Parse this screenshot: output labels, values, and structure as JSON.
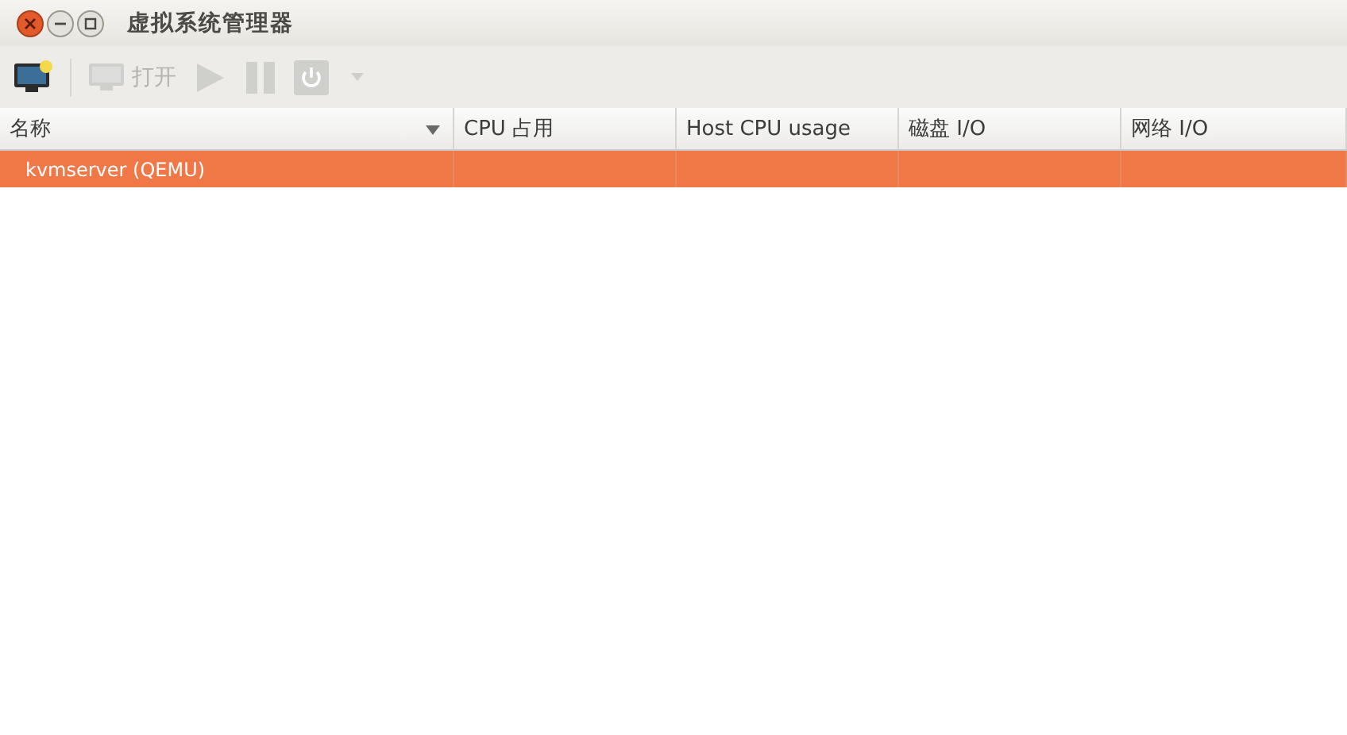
{
  "window": {
    "title": "虚拟系统管理器"
  },
  "toolbar": [
    {
      "kind": "new",
      "disabled": false
    },
    {
      "kind": "open",
      "label": "打开",
      "disabled": true
    },
    {
      "kind": "run",
      "disabled": true
    },
    {
      "kind": "pause",
      "disabled": true
    },
    {
      "kind": "shutdown",
      "disabled": true
    },
    {
      "kind": "menu",
      "disabled": true
    }
  ],
  "table": {
    "columns": [
      {
        "label": "名称",
        "sorted": true
      },
      {
        "label": "CPU 占用",
        "sorted": false
      },
      {
        "label": "Host CPU usage",
        "sorted": false
      },
      {
        "label": "磁盘 I/O",
        "sorted": false
      },
      {
        "label": "网络 I/O",
        "sorted": false
      }
    ],
    "rows": [
      {
        "name": "kvmserver (QEMU)",
        "selected": true
      }
    ]
  }
}
